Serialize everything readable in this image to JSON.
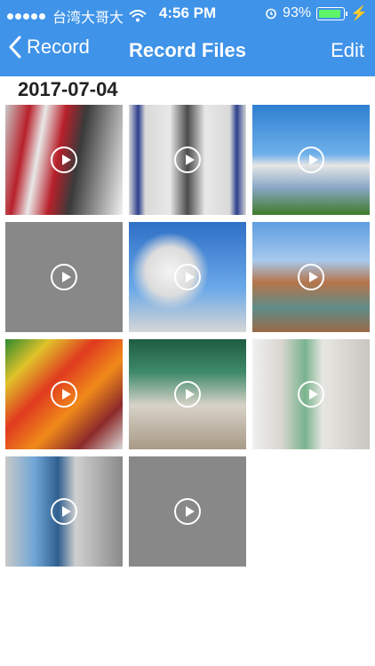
{
  "status_bar": {
    "carrier": "台湾大哥大",
    "time": "4:56 PM",
    "battery": "93%",
    "battery_level": 0.93
  },
  "nav": {
    "back_label": "Record",
    "title": "Record Files",
    "edit_label": "Edit"
  },
  "section": {
    "date": "2017-07-04"
  },
  "videos": [
    {
      "kind": "subway-train-photo"
    },
    {
      "kind": "train-doors-photo"
    },
    {
      "kind": "office-building-photo"
    },
    {
      "kind": "blank-gray"
    },
    {
      "kind": "satellite-dishes-photo"
    },
    {
      "kind": "palace-canal-photo"
    },
    {
      "kind": "fruit-market-photo"
    },
    {
      "kind": "shopping-mall-photo"
    },
    {
      "kind": "hospital-corridor-photo"
    },
    {
      "kind": "elevator-lobby-photo"
    },
    {
      "kind": "blank-gray"
    }
  ]
}
